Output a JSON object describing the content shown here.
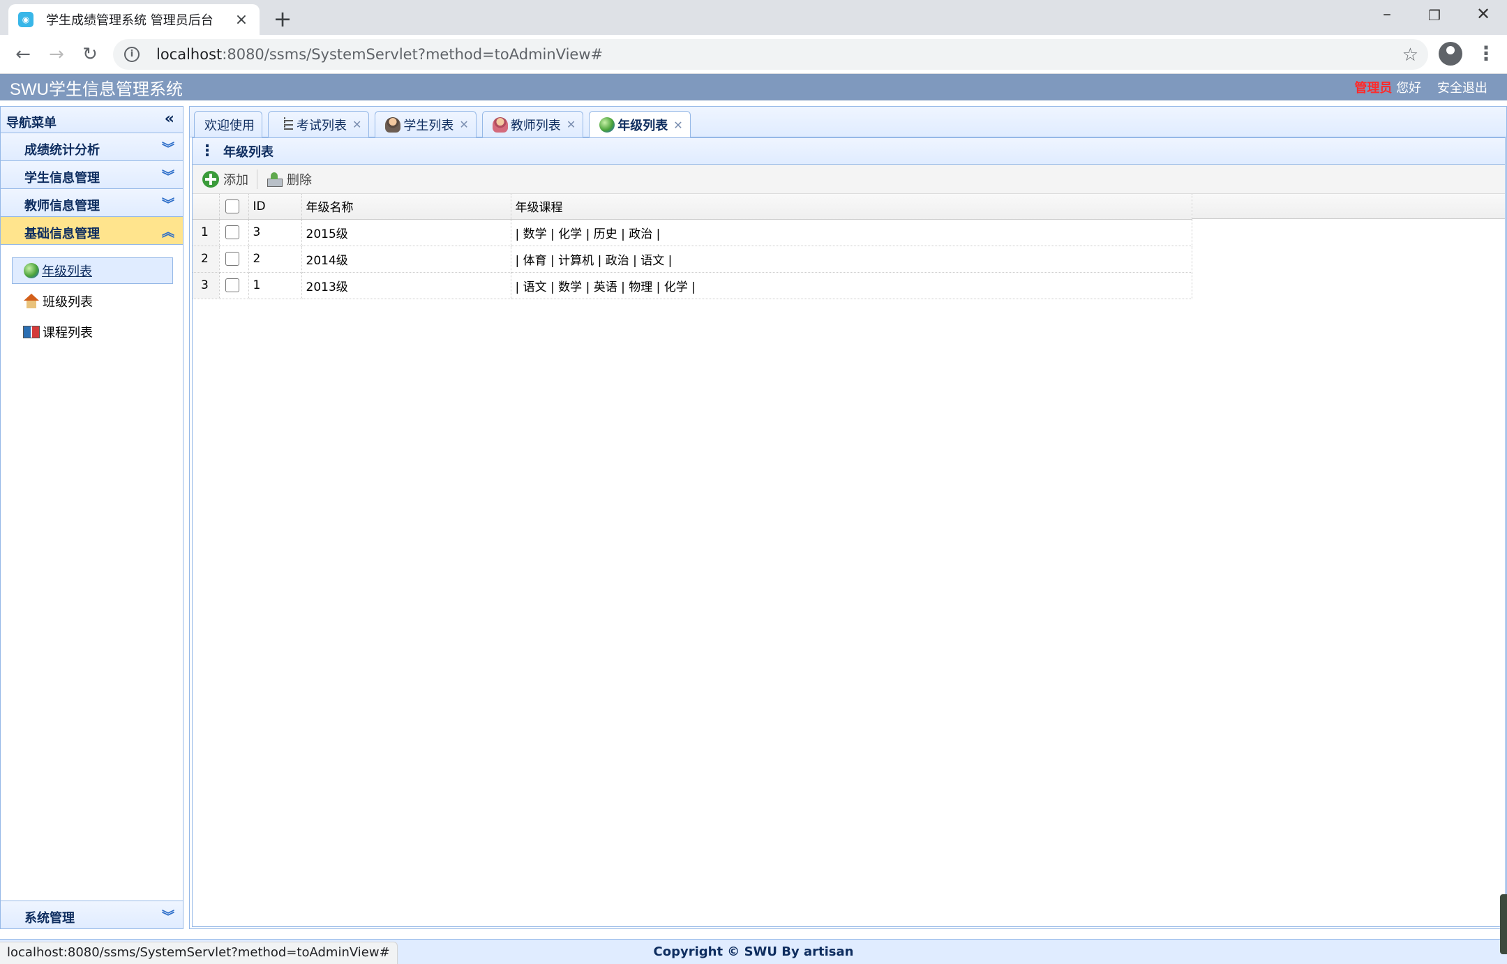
{
  "browser": {
    "tab_title": "学生成绩管理系统 管理员后台",
    "url_host": "localhost",
    "url_rest": ":8080/ssms/SystemServlet?method=toAdminView#",
    "status_url": "localhost:8080/ssms/SystemServlet?method=toAdminView#"
  },
  "header": {
    "title": "SWU学生信息管理系统",
    "role": "管理员",
    "greeting": "您好",
    "logout": "安全退出"
  },
  "sidenav": {
    "title": "导航菜单",
    "sections": [
      {
        "label": "成绩统计分析"
      },
      {
        "label": "学生信息管理"
      },
      {
        "label": "教师信息管理"
      },
      {
        "label": "基础信息管理"
      }
    ],
    "items": [
      {
        "label": "年级列表"
      },
      {
        "label": "班级列表"
      },
      {
        "label": "课程列表"
      }
    ],
    "bottom_section": "系统管理"
  },
  "tabs": [
    {
      "label": "欢迎使用"
    },
    {
      "label": "考试列表"
    },
    {
      "label": "学生列表"
    },
    {
      "label": "教师列表"
    },
    {
      "label": "年级列表"
    }
  ],
  "panel": {
    "title": "年级列表",
    "toolbar": {
      "add": "添加",
      "delete": "删除"
    }
  },
  "grid": {
    "columns": [
      "ID",
      "年级名称",
      "年级课程"
    ],
    "rows": [
      {
        "num": "1",
        "id": "3",
        "name": "2015级",
        "courses": "| 数学 | 化学 | 历史 | 政治 |"
      },
      {
        "num": "2",
        "id": "2",
        "name": "2014级",
        "courses": "| 体育 | 计算机 | 政治 | 语文 |"
      },
      {
        "num": "3",
        "id": "1",
        "name": "2013级",
        "courses": "| 语文 | 数学 | 英语 | 物理 | 化学 |"
      }
    ]
  },
  "footer": {
    "copyright": "Copyright © SWU By artisan"
  }
}
